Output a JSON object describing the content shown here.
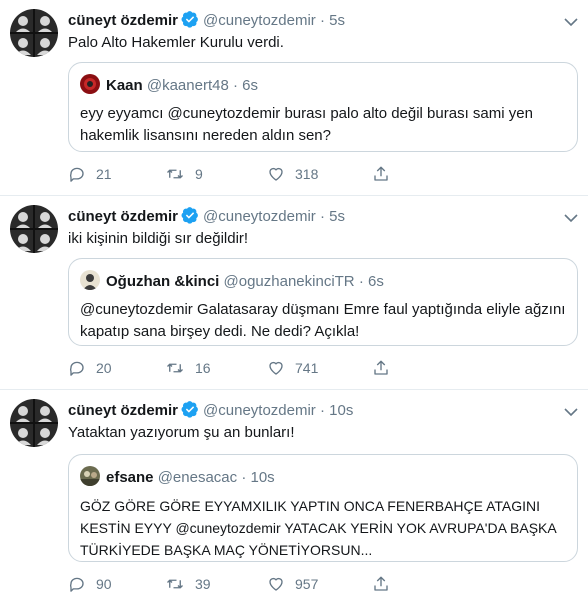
{
  "tweets": [
    {
      "author_name": "cüneyt özdemir",
      "author_handle": "@cuneytozdemir",
      "dot": "·",
      "time": "5s",
      "text": "Palo Alto Hakemler Kurulu verdi.",
      "quote": {
        "name": "Kaan",
        "handle": "@kaanert48",
        "dot": "·",
        "time": "6s",
        "text": "eyy eyyamcı @cuneytozdemir burası palo alto değil burası sami yen hakemlik lisansını nereden aldın sen?"
      },
      "replies": "21",
      "retweets": "9",
      "likes": "318"
    },
    {
      "author_name": "cüneyt özdemir",
      "author_handle": "@cuneytozdemir",
      "dot": "·",
      "time": "5s",
      "text": "iki kişinin bildiği sır değildir!",
      "quote": {
        "name": "Oğuzhan &kinci",
        "handle": "@oguzhanekinciTR",
        "dot": "·",
        "time": "6s",
        "text": "@cuneytozdemir Galatasaray düşmanı Emre faul yaptığında eliyle ağzını kapatıp sana birşey dedi. Ne dedi? Açıkla!"
      },
      "replies": "20",
      "retweets": "16",
      "likes": "741"
    },
    {
      "author_name": "cüneyt özdemir",
      "author_handle": "@cuneytozdemir",
      "dot": "·",
      "time": "10s",
      "text": "Yataktan yazıyorum şu an bunları!",
      "quote": {
        "name": "efsane",
        "handle": "@enesacac",
        "dot": "·",
        "time": "10s",
        "text": "GÖZ GÖRE GÖRE EYYAMXILIK YAPTIN ONCA FENERBAHÇE ATAGINI KESTİN EYYY @cuneytozdemir  YATACAK YERİN YOK AVRUPA'DA BAŞKA TÜRKİYEDE BAŞKA MAÇ YÖNETİYORSUN..."
      },
      "replies": "90",
      "retweets": "39",
      "likes": "957"
    }
  ],
  "colors": {
    "verified": "#1da1f2",
    "secondary_text": "#657786",
    "border": "#ccd6dd",
    "divider": "#e6ecf0"
  },
  "icons": [
    "verified-badge-icon",
    "chevron-down-icon",
    "reply-icon",
    "retweet-icon",
    "like-icon",
    "share-icon"
  ]
}
